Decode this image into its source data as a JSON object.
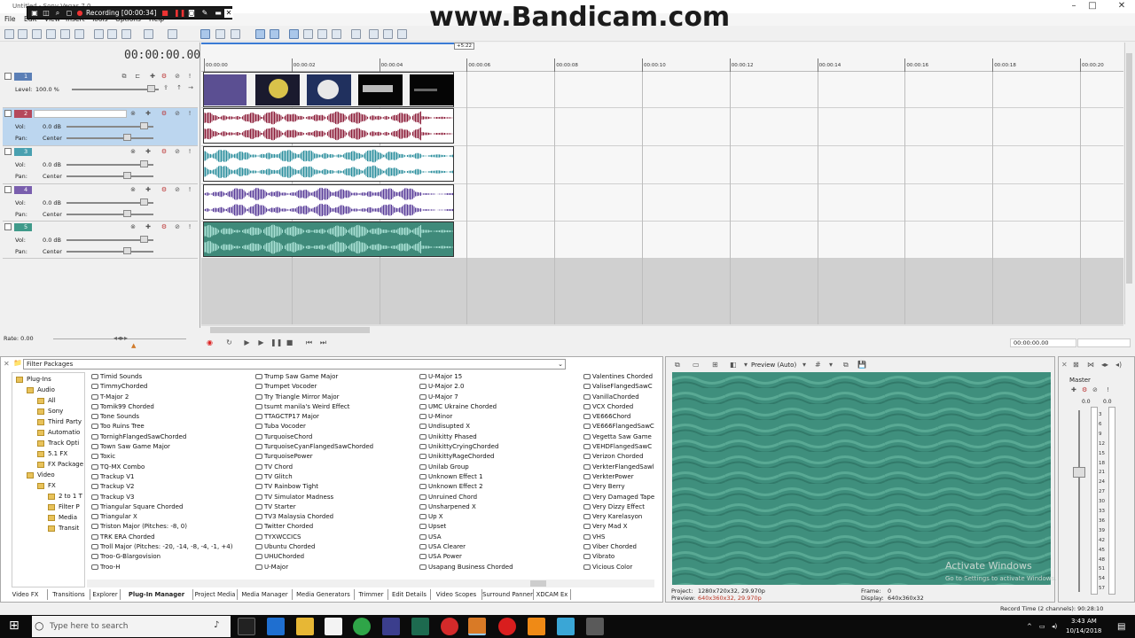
{
  "window": {
    "title": "Untitled - Sony Vegas 7.0"
  },
  "recorder": {
    "text": "Recording [00:00:34]",
    "watermark": "www.Bandicam.com"
  },
  "menu": [
    "File",
    "Edit",
    "View",
    "Insert",
    "Tools",
    "Options",
    "Help"
  ],
  "timecode": "00:00:00.00",
  "ruler": {
    "marker": "+5:22",
    "ticks": [
      "00:00:00",
      "00:00:02",
      "00:00:04",
      "00:00:06",
      "00:00:08",
      "00:00:10",
      "00:00:12",
      "00:00:14",
      "00:00:16",
      "00:00:18",
      "00:00:20"
    ]
  },
  "tracks": [
    {
      "num": "1",
      "color": "#5b7fb6",
      "type": "video",
      "level_label": "Level:",
      "level_value": "100.0 %"
    },
    {
      "num": "2",
      "color": "#b5485b",
      "type": "audio",
      "vol_label": "Vol:",
      "vol_value": "0.0 dB",
      "pan_label": "Pan:",
      "pan_value": "Center",
      "wave": "#8c1e3a"
    },
    {
      "num": "3",
      "color": "#49a0b0",
      "type": "audio",
      "vol_label": "Vol:",
      "vol_value": "0.0 dB",
      "pan_label": "Pan:",
      "pan_value": "Center",
      "wave": "#2d8f9e"
    },
    {
      "num": "4",
      "color": "#7a5fae",
      "type": "audio",
      "vol_label": "Vol:",
      "vol_value": "0.0 dB",
      "pan_label": "Pan:",
      "pan_value": "Center",
      "wave": "#5a3e9a"
    },
    {
      "num": "5",
      "color": "#3f9a8a",
      "type": "audio",
      "vol_label": "Vol:",
      "vol_value": "0.0 dB",
      "pan_label": "Pan:",
      "pan_value": "Center",
      "wave": "#a8e0d4"
    }
  ],
  "rate": "Rate: 0.00",
  "transport_time": "00:00:00.00",
  "filter_packages": "Filter Packages",
  "tree": [
    "Plug-Ins",
    "Audio",
    "All",
    "Sony",
    "Third Party",
    "Automatio",
    "Track Opti",
    "5.1 FX",
    "FX Package",
    "Video",
    "FX",
    "2 to 1 T",
    "Filter P",
    "Media",
    "Transit"
  ],
  "plugins": [
    [
      "Timid Sounds",
      "TimmyChorded",
      "T-Major 2",
      "Tomik99 Chorded",
      "Tone Sounds",
      "Too Ruins Tree",
      "TornighFlangedSawChorded",
      "Town Saw Game Major",
      "Toxic",
      "TQ-MX Combo",
      "Trackup V1",
      "Trackup V2",
      "Trackup V3",
      "Triangular Square Chorded",
      "Triangular X",
      "Triston Major (Pitches: -8, 0)",
      "TRK ERA Chorded",
      "Troll Major (Pitches: -20, -14, -8, -4, -1, +4)",
      "Troo-G-Blargovision",
      "Troo-H"
    ],
    [
      "Trump Saw Game Major",
      "Trumpet Vocoder",
      "Try Triangle Mirror Major",
      "tsumt manila's Weird Effect",
      "TTAGCTP17 Major",
      "Tuba Vocoder",
      "TurquoiseChord",
      "TurquoiseCyanFlangedSawChorded",
      "TurquoisePower",
      "TV Chord",
      "TV Glitch",
      "TV Rainbow Tight",
      "TV Simulator Madness",
      "TV Starter",
      "TV3 Malaysia Chorded",
      "Twitter Chorded",
      "TYXWCCICS",
      "Ubuntu Chorded",
      "UHUChorded",
      "U-Major"
    ],
    [
      "U-Major 15",
      "U-Major 2.0",
      "U-Major 7",
      "UMC Ukraine Chorded",
      "U-Minor",
      "Undisupted X",
      "Unikitty Phased",
      "UnikittyCryingChorded",
      "UnikittyRageChorded",
      "Unilab Group",
      "Unknown Effect 1",
      "Unknown Effect 2",
      "Unruined Chord",
      "Unsharpened X",
      "Upset",
      "USA",
      "USA Clearer",
      "USA Power",
      "Usapang Business Chorded"
    ],
    [
      "Valentines Chorded",
      "ValiseFlangedSawC",
      "VanillaChorded",
      "VCX Chorded",
      "VE666Chord",
      "VE666FlangedSawC",
      "Vegetta Saw Game",
      "VEHDFlangedSawC",
      "Verizon Chorded",
      "VerkterFlangedSawl",
      "VerkterPower",
      "Very Berry",
      "Very Damaged Tape",
      "Very Dizzy Effect",
      "Very Karelasyon",
      "Very Mad X",
      "VHS",
      "Viber Chorded",
      "Vibrato",
      "Vicious Color"
    ]
  ],
  "plugins_extra": "Up X",
  "tabs": [
    "Video FX",
    "Transitions",
    "Explorer",
    "Plug-In Manager",
    "Project Media",
    "Media Manager",
    "Media Generators",
    "Trimmer",
    "Edit Details",
    "Video Scopes",
    "Surround Panner",
    "XDCAM Ex"
  ],
  "preview": {
    "mode": "Preview (Auto)",
    "project_label": "Project:",
    "project_value": "1280x720x32, 29.970p",
    "preview_label": "Preview:",
    "preview_value": "640x360x32, 29.970p",
    "frame_label": "Frame:",
    "frame_value": "0",
    "display_label": "Display:",
    "display_value": "640x360x32",
    "activate1": "Activate Windows",
    "activate2": "Go to Settings to activate Windows."
  },
  "master": {
    "label": "Master",
    "top_values": [
      "0.0",
      "0.0"
    ],
    "scale": [
      "3",
      "6",
      "9",
      "12",
      "15",
      "18",
      "21",
      "24",
      "27",
      "30",
      "33",
      "36",
      "39",
      "42",
      "45",
      "48",
      "51",
      "54",
      "57"
    ]
  },
  "status": "Record Time (2 channels): 90:28:10",
  "taskbar": {
    "search_placeholder": "Type here to search",
    "time": "3:43 AM",
    "date": "10/14/2018"
  },
  "colors": {
    "accent": "#5b7fb6",
    "preview": "#3f8f7d"
  }
}
